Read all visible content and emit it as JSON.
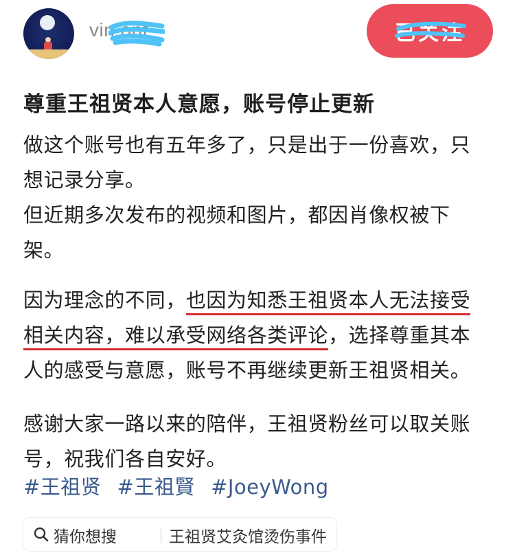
{
  "header": {
    "username": "vin         ont",
    "follow_label": "已关注"
  },
  "post": {
    "title": "尊重王祖贤本人意愿，账号停止更新",
    "para1": [
      "做这个账号也有五年多了，只是出于一份喜欢，只",
      "想记录分享。",
      "但近期多次发布的视频和图片，都因肖像权被下",
      "架。"
    ],
    "para2": {
      "line1_plain": "因为理念的不同，",
      "line1_underlined": "也因为知悉王祖贤本人无法接受",
      "line2_underlined": "相关内容，难以承受网络各类评论",
      "line2_plain": "，选择尊重其本",
      "line3": "人的感受与意愿，账号不再继续更新王祖贤相关。"
    },
    "para3": [
      "感谢大家一路以来的陪伴，王祖贤粉丝可以取关账",
      "号，祝我们各自安好。"
    ],
    "tags": [
      "#王祖贤",
      "#王祖賢",
      "#JoeyWong"
    ]
  },
  "suggest": {
    "guess_label": "猜你想搜",
    "query": "王祖贤艾灸馆烫伤事件"
  },
  "colors": {
    "follow_bg": "#ec4d5a",
    "tag": "#3a5a8c",
    "underline": "#d42a2a",
    "scribble": "#4fc3f7"
  },
  "icons": {
    "search": "search-icon"
  }
}
